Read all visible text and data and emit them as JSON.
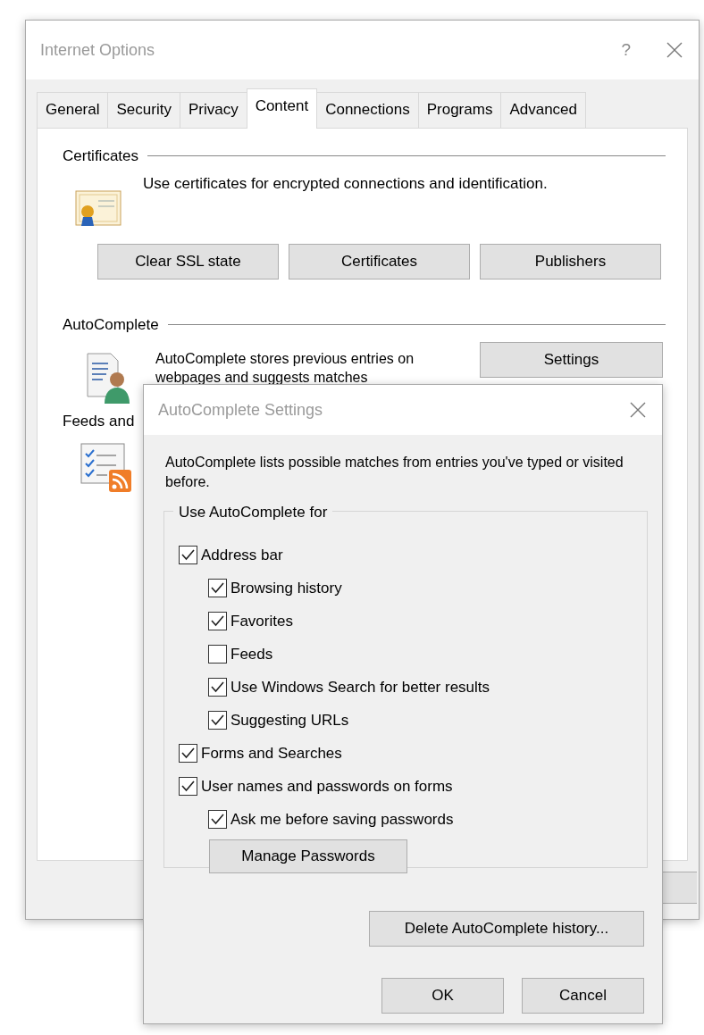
{
  "main_window": {
    "title": "Internet Options",
    "help": "?",
    "tabs": [
      {
        "label": "General",
        "selected": false
      },
      {
        "label": "Security",
        "selected": false
      },
      {
        "label": "Privacy",
        "selected": false
      },
      {
        "label": "Content",
        "selected": true
      },
      {
        "label": "Connections",
        "selected": false
      },
      {
        "label": "Programs",
        "selected": false
      },
      {
        "label": "Advanced",
        "selected": false
      }
    ],
    "certificates": {
      "heading": "Certificates",
      "description": "Use certificates for encrypted connections and identification.",
      "buttons": [
        "Clear SSL state",
        "Certificates",
        "Publishers"
      ]
    },
    "autocomplete": {
      "heading": "AutoComplete",
      "description": "AutoComplete stores previous entries on webpages and suggests matches",
      "button": "Settings"
    },
    "feeds": {
      "heading": "Feeds and"
    }
  },
  "dialog": {
    "title": "AutoComplete Settings",
    "intro": "AutoComplete lists possible matches from entries you've typed or visited before.",
    "group": {
      "legend": "Use AutoComplete for",
      "options": [
        {
          "label": "Address bar",
          "checked": true,
          "children": [
            {
              "label": "Browsing history",
              "checked": true
            },
            {
              "label": "Favorites",
              "checked": true
            },
            {
              "label": "Feeds",
              "checked": false
            },
            {
              "label": "Use Windows Search for better results",
              "checked": true
            },
            {
              "label": "Suggesting URLs",
              "checked": true
            }
          ]
        },
        {
          "label": "Forms and Searches",
          "checked": true
        },
        {
          "label": "User names and passwords on forms",
          "checked": true,
          "children": [
            {
              "label": "Ask me before saving passwords",
              "checked": true
            }
          ]
        }
      ],
      "manage_button": "Manage Passwords"
    },
    "delete_button": "Delete AutoComplete history...",
    "buttons": [
      "OK",
      "Cancel"
    ]
  }
}
